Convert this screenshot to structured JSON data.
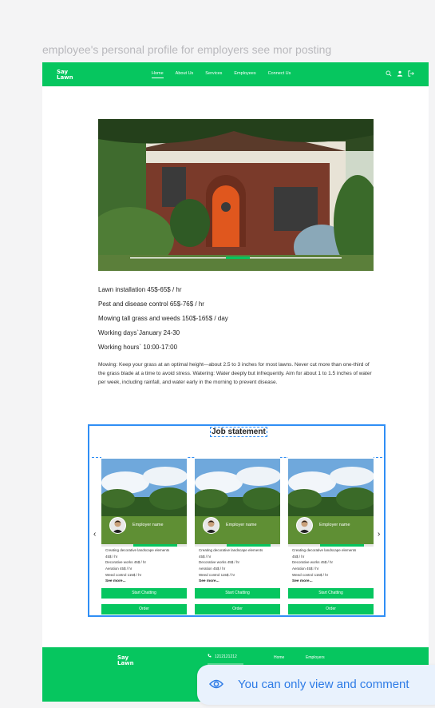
{
  "frame_title": "employee's personal profile for employers see mor posting",
  "brand": {
    "line1": "Say",
    "line2": "Lawn",
    "accent_color": "#06c65f"
  },
  "nav": {
    "links": [
      "Home",
      "About Us",
      "Services",
      "Employees",
      "Connect Us"
    ],
    "active": "Home",
    "icons": [
      "search-icon",
      "user-icon",
      "logout-icon"
    ]
  },
  "details": {
    "lines": [
      "Lawn installation 45$-65$ / hr",
      "Pest and disease control 65$-76$ / hr",
      "Mowing tall grass and weeds 150$-165$ / day",
      "Working days`January 24-30",
      "Working hours` 10:00-17:00"
    ],
    "paragraph": "Mowing: Keep your grass at an optimal height—about 2.5 to 3 inches for most lawns. Never cut more than one-third of the grass blade at a time to avoid stress. Watering: Water deeply but infrequently. Aim for about 1 to 1.5 inches of water per week, including rainfall, and water early in the morning to prevent disease."
  },
  "job": {
    "title": "Job statement",
    "prev": "‹",
    "next": "›",
    "cards": [
      {
        "employer": "Employer name",
        "lines": [
          "Creating decorative landscape elements",
          "45$ / hr",
          "Decorative works 45$ / hr",
          "Aeration 45$ / hr",
          "Weed control 115$ / hr"
        ],
        "see_more": "See more...",
        "chat": "Start Chatting",
        "order": "Order"
      },
      {
        "employer": "Employer name",
        "lines": [
          "Creating decorative landscape elements",
          "45$ / hr",
          "Decorative works 45$ / hr",
          "Aeration 45$ / hr",
          "Weed control 115$ / hr"
        ],
        "see_more": "See more...",
        "chat": "Start Chatting",
        "order": "Order"
      },
      {
        "employer": "Employer name",
        "lines": [
          "Creating decorative landscape elements",
          "45$ / hr",
          "Decorative works 45$ / hr",
          "Aeration 45$ / hr",
          "Weed control 115$ / hr"
        ],
        "see_more": "See more...",
        "chat": "Start Chatting",
        "order": "Order"
      }
    ]
  },
  "footer": {
    "phone": "1212121212",
    "links": [
      "Home",
      "Employers"
    ]
  },
  "toast": {
    "text": "You can only view and comment",
    "icon": "eye-icon"
  }
}
